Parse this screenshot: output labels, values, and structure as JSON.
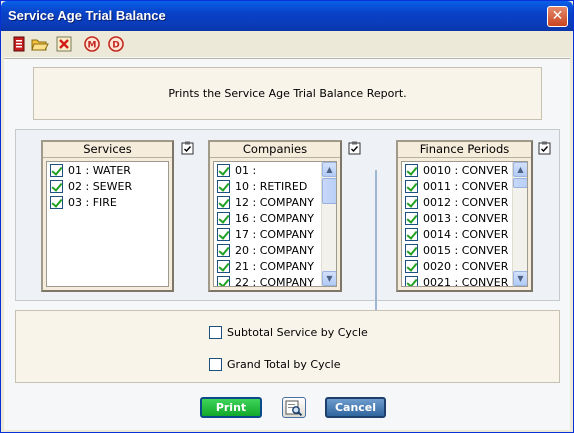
{
  "window": {
    "title": "Service Age Trial Balance",
    "close_label": "✕"
  },
  "toolbar": {
    "icons": [
      "report-icon",
      "open-folder-icon",
      "delete-icon",
      "m-icon",
      "d-icon"
    ],
    "m_label": "M",
    "d_label": "D"
  },
  "description": "Prints the Service Age Trial Balance Report.",
  "services": {
    "header": "Services",
    "items": [
      {
        "label": "01 : WATER",
        "checked": true
      },
      {
        "label": "02 : SEWER",
        "checked": true
      },
      {
        "label": "03 : FIRE",
        "checked": true
      }
    ]
  },
  "companies": {
    "header": "Companies",
    "items": [
      {
        "label": "01 :",
        "checked": true
      },
      {
        "label": "10 : RETIRED",
        "checked": true
      },
      {
        "label": "12 : COMPANY",
        "checked": true
      },
      {
        "label": "16 : COMPANY",
        "checked": true
      },
      {
        "label": "17 : COMPANY",
        "checked": true
      },
      {
        "label": "20 : COMPANY",
        "checked": true
      },
      {
        "label": "21 : COMPANY",
        "checked": true
      },
      {
        "label": "22 : COMPANY",
        "checked": true
      }
    ]
  },
  "finance_periods": {
    "header": "Finance Periods",
    "items": [
      {
        "label": "0010 : CONVER",
        "checked": true
      },
      {
        "label": "0011 : CONVER",
        "checked": true
      },
      {
        "label": "0012 : CONVER",
        "checked": true
      },
      {
        "label": "0013 : CONVER",
        "checked": true
      },
      {
        "label": "0014 : CONVER",
        "checked": true
      },
      {
        "label": "0015 : CONVER",
        "checked": true
      },
      {
        "label": "0020 : CONVER",
        "checked": true
      },
      {
        "label": "0021 : CONVER",
        "checked": true
      }
    ]
  },
  "options": {
    "subtotal_label": "Subtotal Service by Cycle",
    "subtotal_checked": false,
    "grandtotal_label": "Grand Total by Cycle",
    "grandtotal_checked": false
  },
  "buttons": {
    "print": "Print",
    "cancel": "Cancel"
  },
  "colors": {
    "title_bar": "#0842c8",
    "print_button": "#11a82a",
    "cancel_button": "#30659e",
    "check": "#21a121"
  }
}
